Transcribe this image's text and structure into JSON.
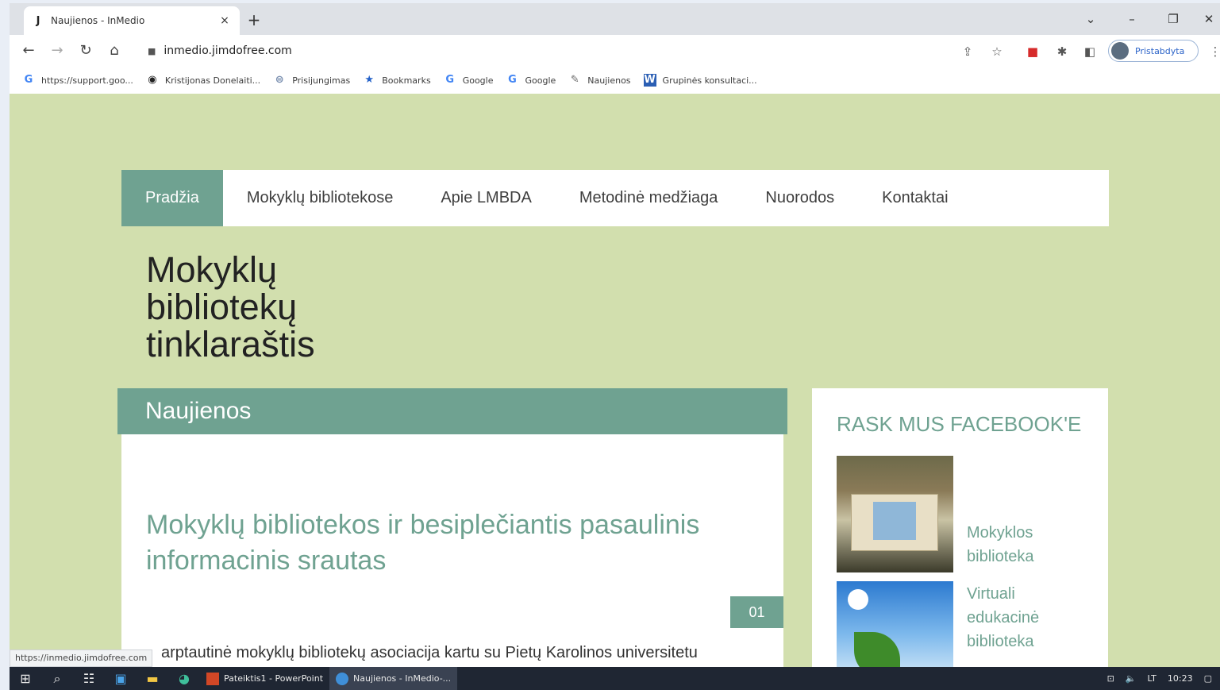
{
  "browser": {
    "tab_title": "Naujienos - InMedio",
    "tab_close": "×",
    "new_tab": "+",
    "url": "inmedio.jimdofree.com",
    "profile_label": "Pristabdyta",
    "window_controls": {
      "chevron": "⌄",
      "minimize": "–",
      "restore": "❐",
      "close": "✕"
    },
    "status_url": "https://inmedio.jimdofree.com"
  },
  "bookmarks": [
    {
      "icon": "G",
      "label": "https://support.goo..."
    },
    {
      "icon": "◉",
      "label": "Kristijonas Donelaiti..."
    },
    {
      "icon": "⊜",
      "label": "Prisijungimas"
    },
    {
      "icon": "★",
      "label": "Bookmarks"
    },
    {
      "icon": "G",
      "label": "Google"
    },
    {
      "icon": "G",
      "label": "Google"
    },
    {
      "icon": "✎",
      "label": "Naujienos"
    },
    {
      "icon": "W",
      "label": "Grupinės konsultaci..."
    }
  ],
  "site": {
    "nav": [
      "Pradžia",
      "Mokyklų bibliotekose",
      "Apie LMBDA",
      "Metodinė medžiaga",
      "Nuorodos",
      "Kontaktai"
    ],
    "title_lines": [
      "Mokyklų",
      "bibliotekų",
      "tinklaraštis"
    ],
    "section_title": "Naujienos",
    "article": {
      "title": "Mokyklų bibliotekos ir besiplečiantis pasaulinis informacinis srautas",
      "date_badge": "01",
      "excerpt": "arptautinė mokyklų bibliotekų asociacija kartu su  Pietų Karolinos universitetu"
    },
    "sidebar": {
      "heading": "RASK MUS FACEBOOK'E",
      "links": [
        {
          "line1": "Mokyklos",
          "line2": "biblioteka"
        },
        {
          "line1": "Virtuali",
          "line2": "edukacinė",
          "line3": "biblioteka"
        }
      ]
    }
  },
  "taskbar": {
    "apps": [
      "Pateiktis1 - PowerPoint",
      "Naujienos - InMedio-..."
    ],
    "tray_lang": "LT",
    "tray_time": "10:23"
  },
  "colors": {
    "accent": "#6fa291",
    "page_bg": "#d2dfae"
  }
}
